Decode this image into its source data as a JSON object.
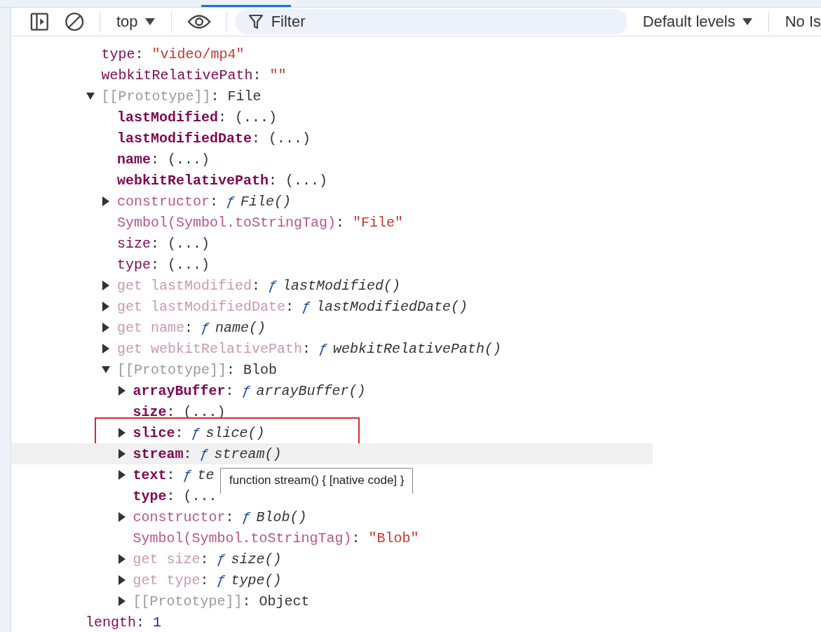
{
  "toolbar": {
    "context": "top",
    "filter": {
      "placeholder": "Filter"
    },
    "levels": "Default levels",
    "issues": "No Is"
  },
  "tree": {
    "items": [
      {
        "key": "type",
        "kind": "string",
        "sep": ": ",
        "value": "\"video/mp4\"",
        "highlighted": false,
        "boxed": false
      },
      {
        "key": "webkitRelativePath",
        "kind": "string",
        "sep": ": ",
        "value": "\"\"",
        "highlighted": false,
        "boxed": false
      },
      {
        "key": "[[Prototype]]",
        "kind": "proto",
        "sep": ": ",
        "value": "File",
        "expanded": true,
        "highlighted": false,
        "boxed": false,
        "children": [
          {
            "key": "lastModified",
            "kind": "ownlazy",
            "sep": ": ",
            "value": "(...)",
            "highlighted": false,
            "boxed": false
          },
          {
            "key": "lastModifiedDate",
            "kind": "ownlazy",
            "sep": ": ",
            "value": "(...)",
            "highlighted": false,
            "boxed": false
          },
          {
            "key": "name",
            "kind": "ownlazy",
            "sep": ": ",
            "value": "(...)",
            "highlighted": false,
            "boxed": false
          },
          {
            "key": "webkitRelativePath",
            "kind": "ownlazy",
            "sep": ": ",
            "value": "(...)",
            "highlighted": false,
            "boxed": false
          },
          {
            "key": "constructor",
            "kind": "protofunc",
            "sep": ": ",
            "prefix": "ƒ",
            "value": "File()",
            "expanded": false,
            "highlighted": false,
            "boxed": false
          },
          {
            "key": "Symbol(Symbol.toStringTag)",
            "kind": "tag",
            "sep": ": ",
            "value": "\"File\"",
            "highlighted": false,
            "boxed": false
          },
          {
            "key": "size",
            "kind": "lazy",
            "sep": ": ",
            "value": "(...)",
            "highlighted": false,
            "boxed": false
          },
          {
            "key": "type",
            "kind": "lazy",
            "sep": ": ",
            "value": "(...)",
            "highlighted": false,
            "boxed": false
          },
          {
            "key": "get lastModified",
            "kind": "getter",
            "sep": ": ",
            "prefix": "ƒ",
            "value": "lastModified()",
            "expanded": false,
            "highlighted": false,
            "boxed": false
          },
          {
            "key": "get lastModifiedDate",
            "kind": "getter",
            "sep": ": ",
            "prefix": "ƒ",
            "value": "lastModifiedDate()",
            "expanded": false,
            "highlighted": false,
            "boxed": false
          },
          {
            "key": "get name",
            "kind": "getter",
            "sep": ": ",
            "prefix": "ƒ",
            "value": "name()",
            "expanded": false,
            "highlighted": false,
            "boxed": false
          },
          {
            "key": "get webkitRelativePath",
            "kind": "getter",
            "sep": ": ",
            "prefix": "ƒ",
            "value": "webkitRelativePath()",
            "expanded": false,
            "highlighted": false,
            "boxed": false
          },
          {
            "key": "[[Prototype]]",
            "kind": "proto",
            "sep": ": ",
            "value": "Blob",
            "expanded": true,
            "highlighted": false,
            "boxed": false,
            "children": [
              {
                "key": "arrayBuffer",
                "kind": "ownfunc",
                "sep": ": ",
                "prefix": "ƒ",
                "value": "arrayBuffer()",
                "expanded": false,
                "highlighted": false,
                "boxed": false
              },
              {
                "key": "size",
                "kind": "ownlazy",
                "sep": ": ",
                "value": "(...)",
                "highlighted": false,
                "boxed": false
              },
              {
                "key": "slice",
                "kind": "ownfunc",
                "sep": ": ",
                "prefix": "ƒ",
                "value": "slice()",
                "expanded": false,
                "highlighted": false,
                "boxed": true
              },
              {
                "key": "stream",
                "kind": "ownfunc",
                "sep": ": ",
                "prefix": "ƒ",
                "value": "stream()",
                "expanded": false,
                "highlighted": true,
                "boxed": false
              },
              {
                "key": "text",
                "kind": "ownfunc",
                "sep": ": ",
                "prefix": "ƒ",
                "value": "te",
                "expanded": false,
                "highlighted": false,
                "boxed": false
              },
              {
                "key": "type",
                "kind": "ownlazy",
                "sep": ": ",
                "value": "(...",
                "highlighted": false,
                "boxed": false
              },
              {
                "key": "constructor",
                "kind": "protofunc",
                "sep": ": ",
                "prefix": "ƒ",
                "value": "Blob()",
                "expanded": false,
                "highlighted": false,
                "boxed": false
              },
              {
                "key": "Symbol(Symbol.toStringTag)",
                "kind": "tag",
                "sep": ": ",
                "value": "\"Blob\"",
                "highlighted": false,
                "boxed": false
              },
              {
                "key": "get size",
                "kind": "getter",
                "sep": ": ",
                "prefix": "ƒ",
                "value": "size()",
                "expanded": false,
                "highlighted": false,
                "boxed": false
              },
              {
                "key": "get type",
                "kind": "getter",
                "sep": ": ",
                "prefix": "ƒ",
                "value": "type()",
                "expanded": false,
                "highlighted": false,
                "boxed": false
              },
              {
                "key": "[[Prototype]]",
                "kind": "proto",
                "sep": ": ",
                "value": "Object",
                "expanded": false,
                "highlighted": false,
                "boxed": false
              }
            ]
          }
        ]
      }
    ],
    "after": [
      {
        "key": "length",
        "kind": "number",
        "sep": ": ",
        "value": "1",
        "highlighted": false,
        "boxed": false
      }
    ]
  },
  "tooltip": {
    "text": "function stream() { [native code] }"
  }
}
